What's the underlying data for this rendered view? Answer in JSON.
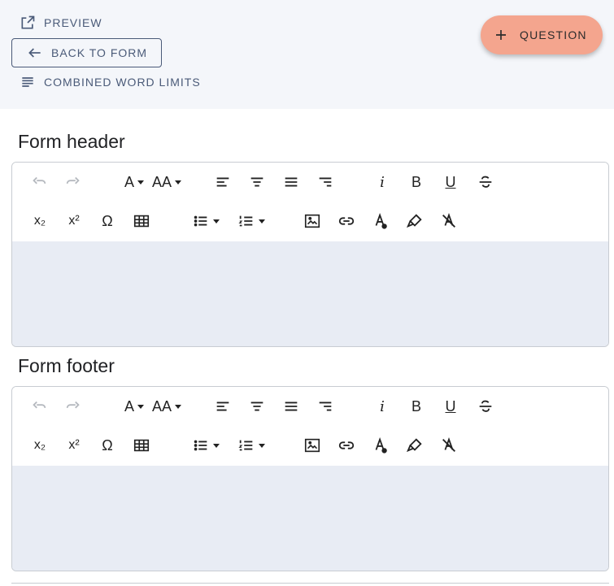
{
  "topbar": {
    "preview_label": "PREVIEW",
    "back_label": "BACK TO FORM",
    "combined_label": "COMBINED WORD LIMITS",
    "add_question_label": "QUESTION"
  },
  "sections": {
    "header_title": "Form header",
    "footer_title": "Form footer"
  },
  "toolbar": {
    "font_label": "A",
    "font_size_label": "AA",
    "italic_label": "i",
    "bold_label": "B",
    "underline_label": "U",
    "subscript_label": "x₂",
    "superscript_label": "x²",
    "special_char_label": "Ω"
  },
  "colors": {
    "accent": "#f4a58e",
    "topbar_bg": "#f4f6fa",
    "editor_body_bg": "#e8ecf4",
    "link_text": "#4a5a78"
  }
}
